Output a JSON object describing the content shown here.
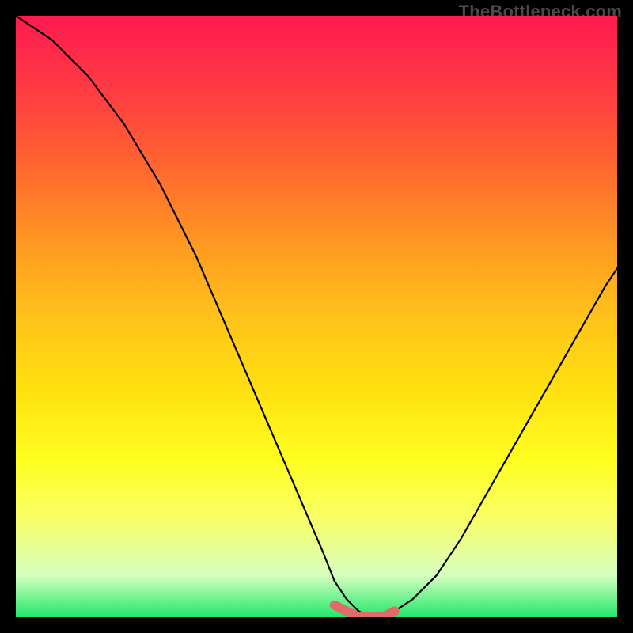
{
  "attribution": "TheBottleneck.com",
  "chart_data": {
    "type": "line",
    "title": "",
    "xlabel": "",
    "ylabel": "",
    "xlim": [
      0,
      100
    ],
    "ylim": [
      0,
      100
    ],
    "series": [
      {
        "name": "bottleneck-curve",
        "x": [
          0,
          3,
          6,
          9,
          12,
          15,
          18,
          21,
          24,
          27,
          30,
          33,
          36,
          39,
          42,
          45,
          48,
          51,
          53,
          55,
          57,
          59,
          61,
          63,
          66,
          70,
          74,
          78,
          82,
          86,
          90,
          94,
          98,
          100
        ],
        "values": [
          100,
          98,
          96,
          93,
          90,
          86,
          82,
          77,
          72,
          66,
          60,
          53,
          46,
          39,
          32,
          25,
          18,
          11,
          6,
          3,
          1,
          0,
          0,
          1,
          3,
          7,
          13,
          20,
          27,
          34,
          41,
          48,
          55,
          58
        ]
      }
    ],
    "marker": {
      "name": "highlight-band",
      "color": "#e26a6a",
      "x": [
        53,
        55,
        57,
        59,
        61,
        63
      ],
      "values": [
        2,
        1,
        0,
        0,
        0,
        1
      ]
    },
    "background_gradient": {
      "stops": [
        {
          "pos": 0,
          "color": "#ff1a50"
        },
        {
          "pos": 50,
          "color": "#ffc21a"
        },
        {
          "pos": 80,
          "color": "#ffff20"
        },
        {
          "pos": 100,
          "color": "#20e86a"
        }
      ]
    }
  }
}
